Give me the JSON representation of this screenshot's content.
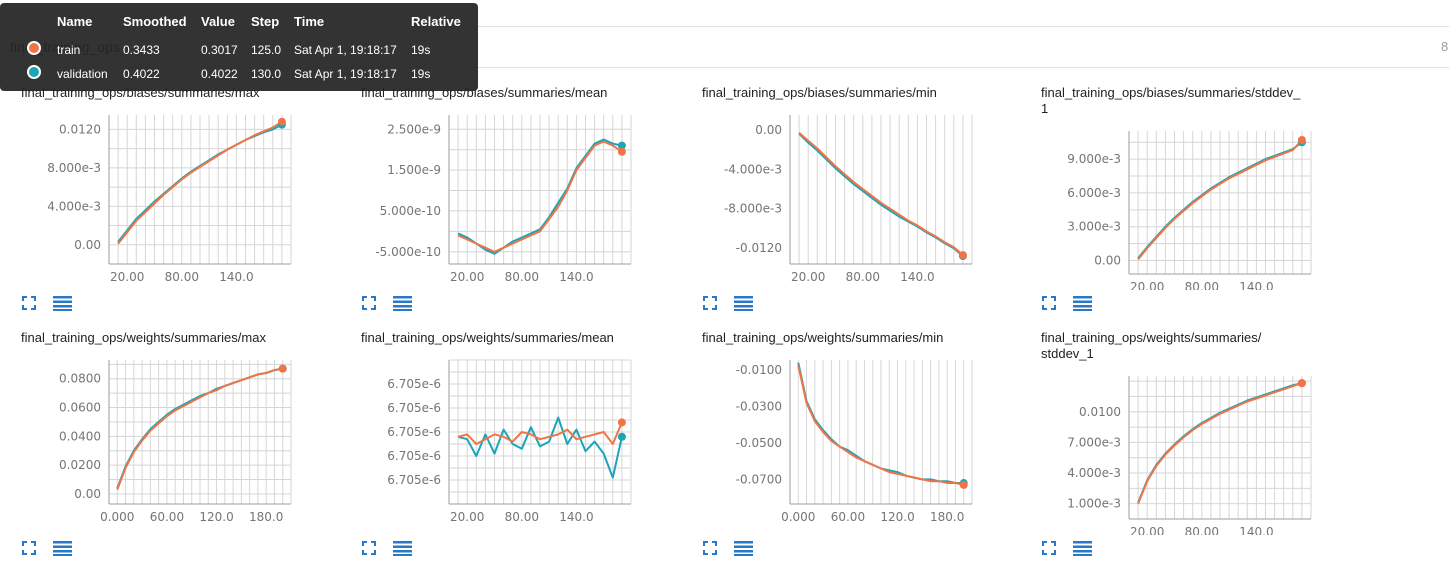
{
  "topbar": {
    "run_title": "final_training_ops",
    "count": "8"
  },
  "tooltip": {
    "headers": [
      "Name",
      "Smoothed",
      "Value",
      "Step",
      "Time",
      "Relative"
    ],
    "rows": [
      {
        "name": "train",
        "smoothed": "0.3433",
        "value": "0.3017",
        "step": "125.0",
        "time": "Sat Apr 1, 19:18:17",
        "relative": "19s",
        "color": "#f07447"
      },
      {
        "name": "validation",
        "smoothed": "0.4022",
        "value": "0.4022",
        "step": "130.0",
        "time": "Sat Apr 1, 19:18:17",
        "relative": "19s",
        "color": "#1aa6b7"
      }
    ]
  },
  "colors": {
    "train": "#f07447",
    "validation": "#1aa6b7",
    "grid": "#d6d6d6",
    "button": "#2979c6"
  },
  "icons": {
    "expand": "expand-icon",
    "data_table": "data-table-icon"
  },
  "chart_data": [
    {
      "type": "line",
      "title_lines": [
        "final_training_ops/biases/summaries/max"
      ],
      "xlim": [
        0,
        200
      ],
      "ylim": [
        -0.002,
        0.0135
      ],
      "xticks": [
        20,
        80,
        140
      ],
      "xtick_labels": [
        "20.00",
        "80.00",
        "140.0"
      ],
      "yticks": [
        0,
        0.004,
        0.008,
        0.012
      ],
      "ytick_labels": [
        "0.00",
        "4.000e-3",
        "8.000e-3",
        "0.0120"
      ],
      "series": [
        {
          "name": "train",
          "x": [
            10,
            20,
            30,
            40,
            50,
            60,
            70,
            80,
            90,
            100,
            110,
            120,
            130,
            140,
            150,
            160,
            170,
            180,
            190
          ],
          "y": [
            0.0001,
            0.0013,
            0.0025,
            0.0034,
            0.0043,
            0.0052,
            0.006,
            0.0068,
            0.0075,
            0.0081,
            0.0087,
            0.0093,
            0.0099,
            0.0104,
            0.0109,
            0.0114,
            0.0118,
            0.0122,
            0.0128
          ]
        },
        {
          "name": "validation",
          "x": [
            10,
            20,
            30,
            40,
            50,
            60,
            70,
            80,
            90,
            100,
            110,
            120,
            130,
            140,
            150,
            160,
            170,
            180,
            190
          ],
          "y": [
            0.0003,
            0.0015,
            0.0027,
            0.0036,
            0.0045,
            0.0053,
            0.0061,
            0.0069,
            0.0076,
            0.0082,
            0.0088,
            0.0094,
            0.0099,
            0.0104,
            0.0109,
            0.0113,
            0.0117,
            0.012,
            0.0125
          ]
        }
      ]
    },
    {
      "type": "line",
      "title_lines": [
        "final_training_ops/biases/summaries/mean"
      ],
      "xlim": [
        0,
        200
      ],
      "ylim": [
        -8e-10,
        2.85e-09
      ],
      "xticks": [
        20,
        80,
        140
      ],
      "xtick_labels": [
        "20.00",
        "80.00",
        "140.0"
      ],
      "yticks": [
        -5e-10,
        5e-10,
        1.5e-09,
        2.5e-09
      ],
      "ytick_labels": [
        "-5.000e-10",
        "5.000e-10",
        "1.500e-9",
        "2.500e-9"
      ],
      "series": [
        {
          "name": "train",
          "x": [
            10,
            20,
            30,
            40,
            50,
            60,
            70,
            80,
            90,
            100,
            110,
            120,
            130,
            140,
            150,
            160,
            170,
            180,
            190
          ],
          "y": [
            -1e-10,
            -2e-10,
            -3e-10,
            -4e-10,
            -5e-10,
            -4e-10,
            -3e-10,
            -2e-10,
            -1e-10,
            0,
            3e-10,
            6e-10,
            1e-09,
            1.5e-09,
            1.8e-09,
            2.1e-09,
            2.2e-09,
            2.1e-09,
            1.95e-09
          ]
        },
        {
          "name": "validation",
          "x": [
            10,
            20,
            30,
            40,
            50,
            60,
            70,
            80,
            90,
            100,
            110,
            120,
            130,
            140,
            150,
            160,
            170,
            180,
            190
          ],
          "y": [
            -5e-11,
            -1.5e-10,
            -3e-10,
            -4.5e-10,
            -5.5e-10,
            -4e-10,
            -2.5e-10,
            -1.5e-10,
            -5e-11,
            5e-11,
            3.5e-10,
            7e-10,
            1.05e-09,
            1.55e-09,
            1.85e-09,
            2.15e-09,
            2.25e-09,
            2.15e-09,
            2.1e-09
          ]
        }
      ]
    },
    {
      "type": "line",
      "title_lines": [
        "final_training_ops/biases/summaries/min"
      ],
      "xlim": [
        0,
        200
      ],
      "ylim": [
        -0.0136,
        0.0015
      ],
      "xticks": [
        20,
        80,
        140
      ],
      "xtick_labels": [
        "20.00",
        "80.00",
        "140.0"
      ],
      "yticks": [
        0,
        -0.004,
        -0.008,
        -0.012
      ],
      "ytick_labels": [
        "0.00",
        "-4.000e-3",
        "-8.000e-3",
        "-0.0120"
      ],
      "series": [
        {
          "name": "train",
          "x": [
            10,
            20,
            30,
            40,
            50,
            60,
            70,
            80,
            90,
            100,
            110,
            120,
            130,
            140,
            150,
            160,
            170,
            180,
            190
          ],
          "y": [
            -0.0003,
            -0.0011,
            -0.0019,
            -0.0028,
            -0.0037,
            -0.0045,
            -0.0053,
            -0.006,
            -0.0067,
            -0.0074,
            -0.008,
            -0.0086,
            -0.0092,
            -0.0097,
            -0.0103,
            -0.0108,
            -0.0114,
            -0.0119,
            -0.0127
          ]
        },
        {
          "name": "validation",
          "x": [
            10,
            20,
            30,
            40,
            50,
            60,
            70,
            80,
            90,
            100,
            110,
            120,
            130,
            140,
            150,
            160,
            170,
            180,
            190
          ],
          "y": [
            -0.0004,
            -0.0013,
            -0.0021,
            -0.003,
            -0.0039,
            -0.0047,
            -0.0055,
            -0.0062,
            -0.0069,
            -0.0076,
            -0.0082,
            -0.0088,
            -0.0093,
            -0.0098,
            -0.0104,
            -0.0109,
            -0.0115,
            -0.012,
            -0.0128
          ]
        }
      ]
    },
    {
      "type": "line",
      "title_lines": [
        "final_training_ops/biases/summaries/stddev_",
        "1"
      ],
      "xlim": [
        0,
        200
      ],
      "ylim": [
        -0.0012,
        0.0115
      ],
      "xticks": [
        20,
        80,
        140
      ],
      "xtick_labels": [
        "20.00",
        "80.00",
        "140.0"
      ],
      "yticks": [
        0,
        0.003,
        0.006,
        0.009
      ],
      "ytick_labels": [
        "0.00",
        "3.000e-3",
        "6.000e-3",
        "9.000e-3"
      ],
      "series": [
        {
          "name": "train",
          "x": [
            10,
            20,
            30,
            40,
            50,
            60,
            70,
            80,
            90,
            100,
            110,
            120,
            130,
            140,
            150,
            160,
            170,
            180,
            190
          ],
          "y": [
            0.0001,
            0.0011,
            0.002,
            0.0029,
            0.0037,
            0.0044,
            0.0051,
            0.0057,
            0.0063,
            0.0068,
            0.0073,
            0.0077,
            0.0081,
            0.0085,
            0.0089,
            0.0092,
            0.0095,
            0.0098,
            0.0107
          ]
        },
        {
          "name": "validation",
          "x": [
            10,
            20,
            30,
            40,
            50,
            60,
            70,
            80,
            90,
            100,
            110,
            120,
            130,
            140,
            150,
            160,
            170,
            180,
            190
          ],
          "y": [
            0.0002,
            0.0012,
            0.0021,
            0.003,
            0.0038,
            0.0045,
            0.0052,
            0.0058,
            0.0064,
            0.0069,
            0.0074,
            0.0078,
            0.0082,
            0.0086,
            0.009,
            0.0093,
            0.0096,
            0.0099,
            0.0105
          ]
        }
      ]
    },
    {
      "type": "line",
      "title_lines": [
        "final_training_ops/weights/summaries/max"
      ],
      "xlim": [
        -10,
        210
      ],
      "ylim": [
        -0.007,
        0.093
      ],
      "xticks": [
        0,
        60,
        120,
        180
      ],
      "xtick_labels": [
        "0.000",
        "60.00",
        "120.0",
        "180.0"
      ],
      "yticks": [
        0,
        0.02,
        0.04,
        0.06,
        0.08
      ],
      "ytick_labels": [
        "0.00",
        "0.0200",
        "0.0400",
        "0.0600",
        "0.0800"
      ],
      "series": [
        {
          "name": "train",
          "x": [
            0,
            10,
            20,
            30,
            40,
            50,
            60,
            70,
            80,
            90,
            100,
            110,
            120,
            130,
            140,
            150,
            160,
            170,
            180,
            190,
            200
          ],
          "y": [
            0.003,
            0.018,
            0.029,
            0.037,
            0.044,
            0.049,
            0.054,
            0.058,
            0.061,
            0.064,
            0.067,
            0.07,
            0.072,
            0.075,
            0.077,
            0.079,
            0.081,
            0.083,
            0.084,
            0.086,
            0.087
          ]
        },
        {
          "name": "validation",
          "x": [
            0,
            10,
            20,
            30,
            40,
            50,
            60,
            70,
            80,
            90,
            100,
            110,
            120,
            130,
            140,
            150,
            160,
            170,
            180,
            190,
            200
          ],
          "y": [
            0.004,
            0.019,
            0.03,
            0.038,
            0.045,
            0.05,
            0.055,
            0.059,
            0.062,
            0.065,
            0.068,
            0.07,
            0.073,
            0.075,
            0.077,
            0.079,
            0.081,
            0.083,
            0.084,
            0.086,
            0.087
          ]
        }
      ]
    },
    {
      "type": "line",
      "title_lines": [
        "final_training_ops/weights/summaries/mean"
      ],
      "xlim": [
        0,
        200
      ],
      "ylim": [
        0,
        6
      ],
      "xticks": [
        20,
        80,
        140
      ],
      "xtick_labels": [
        "20.00",
        "80.00",
        "140.0"
      ],
      "yticks": [
        1,
        2,
        3,
        4,
        5
      ],
      "ytick_labels": [
        "6.705e-6",
        "6.705e-6",
        "6.705e-6",
        "6.705e-6",
        "6.705e-6"
      ],
      "series": [
        {
          "name": "train",
          "x": [
            10,
            20,
            30,
            40,
            50,
            60,
            70,
            80,
            90,
            100,
            110,
            120,
            130,
            140,
            150,
            160,
            170,
            180,
            190
          ],
          "y": [
            2.8,
            2.9,
            2.5,
            2.7,
            2.9,
            2.8,
            2.6,
            3.0,
            2.9,
            2.7,
            2.8,
            2.9,
            3.1,
            2.7,
            2.8,
            2.9,
            3.0,
            2.5,
            3.4
          ]
        },
        {
          "name": "validation",
          "x": [
            10,
            20,
            30,
            40,
            50,
            60,
            70,
            80,
            90,
            100,
            110,
            120,
            130,
            140,
            150,
            160,
            170,
            180,
            190
          ],
          "y": [
            2.8,
            2.7,
            2.0,
            2.9,
            2.1,
            3.1,
            2.5,
            2.3,
            3.2,
            2.4,
            2.6,
            3.6,
            2.5,
            3.1,
            2.2,
            2.6,
            2.1,
            1.1,
            2.8
          ]
        }
      ]
    },
    {
      "type": "line",
      "title_lines": [
        "final_training_ops/weights/summaries/min"
      ],
      "xlim": [
        -10,
        210
      ],
      "ylim": [
        -0.0835,
        -0.0045
      ],
      "xticks": [
        0,
        60,
        120,
        180
      ],
      "xtick_labels": [
        "0.000",
        "60.00",
        "120.0",
        "180.0"
      ],
      "yticks": [
        -0.01,
        -0.03,
        -0.05,
        -0.07
      ],
      "ytick_labels": [
        "-0.0100",
        "-0.0300",
        "-0.0500",
        "-0.0700"
      ],
      "series": [
        {
          "name": "train",
          "x": [
            0,
            10,
            20,
            30,
            40,
            50,
            60,
            70,
            80,
            90,
            100,
            110,
            120,
            130,
            140,
            150,
            160,
            170,
            180,
            190,
            200
          ],
          "y": [
            -0.0075,
            -0.028,
            -0.038,
            -0.044,
            -0.049,
            -0.052,
            -0.055,
            -0.058,
            -0.06,
            -0.062,
            -0.064,
            -0.066,
            -0.067,
            -0.068,
            -0.069,
            -0.07,
            -0.071,
            -0.071,
            -0.072,
            -0.072,
            -0.073
          ]
        },
        {
          "name": "validation",
          "x": [
            0,
            10,
            20,
            30,
            40,
            50,
            60,
            70,
            80,
            90,
            100,
            110,
            120,
            130,
            140,
            150,
            160,
            170,
            180,
            190,
            200
          ],
          "y": [
            -0.006,
            -0.027,
            -0.037,
            -0.043,
            -0.048,
            -0.052,
            -0.054,
            -0.057,
            -0.06,
            -0.062,
            -0.064,
            -0.065,
            -0.066,
            -0.068,
            -0.069,
            -0.07,
            -0.07,
            -0.071,
            -0.071,
            -0.072,
            -0.072
          ]
        }
      ]
    },
    {
      "type": "line",
      "title_lines": [
        "final_training_ops/weights/summaries/",
        "stddev_1"
      ],
      "xlim": [
        0,
        200
      ],
      "ylim": [
        -0.0005,
        0.0135
      ],
      "xticks": [
        20,
        80,
        140
      ],
      "xtick_labels": [
        "20.00",
        "80.00",
        "140.0"
      ],
      "yticks": [
        0.001,
        0.004,
        0.007,
        0.01
      ],
      "ytick_labels": [
        "1.000e-3",
        "4.000e-3",
        "7.000e-3",
        "0.0100"
      ],
      "series": [
        {
          "name": "train",
          "x": [
            10,
            20,
            30,
            40,
            50,
            60,
            70,
            80,
            90,
            100,
            110,
            120,
            130,
            140,
            150,
            160,
            170,
            180,
            190
          ],
          "y": [
            0.001,
            0.0032,
            0.0047,
            0.0058,
            0.0067,
            0.0075,
            0.0082,
            0.0088,
            0.0093,
            0.0098,
            0.0102,
            0.0106,
            0.011,
            0.0113,
            0.0116,
            0.0119,
            0.0122,
            0.0125,
            0.0128
          ]
        },
        {
          "name": "validation",
          "x": [
            10,
            20,
            30,
            40,
            50,
            60,
            70,
            80,
            90,
            100,
            110,
            120,
            130,
            140,
            150,
            160,
            170,
            180,
            190
          ],
          "y": [
            0.0011,
            0.0033,
            0.0048,
            0.0059,
            0.0068,
            0.0076,
            0.0083,
            0.0089,
            0.0094,
            0.0099,
            0.0103,
            0.0107,
            0.0111,
            0.0114,
            0.0117,
            0.012,
            0.0123,
            0.0126,
            0.0128
          ]
        }
      ]
    }
  ]
}
